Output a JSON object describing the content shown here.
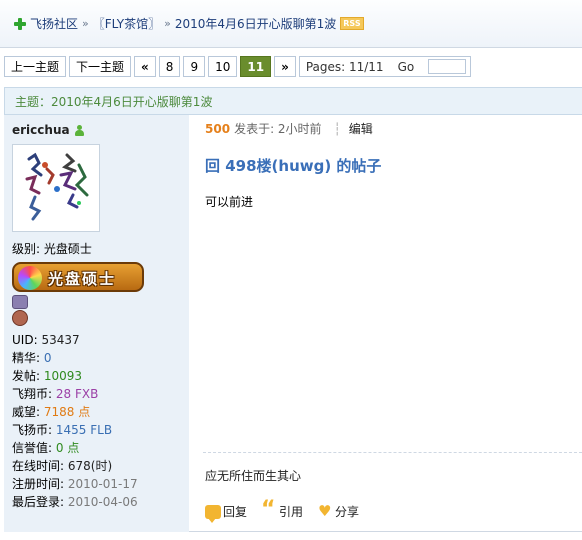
{
  "breadcrumb": {
    "items": [
      "飞扬社区",
      "〖FLY茶馆〗",
      "2010年4月6日开心版聊第1波"
    ],
    "separator": "»",
    "rss": "RSS"
  },
  "pager": {
    "prev_topic": "上一主题",
    "next_topic": "下一主题",
    "first": "«",
    "pages": [
      "8",
      "9",
      "10",
      "11"
    ],
    "current_page": "11",
    "next": "»",
    "pages_info": "Pages: 11/11",
    "go_label": "Go"
  },
  "subject": "主题：2010年4月6日开心版聊第1波",
  "author": {
    "name": "ericchua",
    "level": "级别: 光盘硕士",
    "badge_text": "光盘硕士",
    "stats": [
      {
        "label": "UID:",
        "value": "53437",
        "color": "#222222"
      },
      {
        "label": "精华:",
        "value": "0",
        "color": "#3a6fb3"
      },
      {
        "label": "发帖:",
        "value": "10093",
        "color": "#2f8a1e"
      },
      {
        "label": "飞翔币:",
        "value": "28 FXB",
        "color": "#9b3fa6"
      },
      {
        "label": "威望:",
        "value": "7188 点",
        "color": "#e07b14"
      },
      {
        "label": "飞扬币:",
        "value": "1455 FLB",
        "color": "#3a6fb3"
      },
      {
        "label": "信誉值:",
        "value": "0 点",
        "color": "#2f8a1e"
      },
      {
        "label": "在线时间:",
        "value": "678(时)",
        "color": "#222222"
      },
      {
        "label": "注册时间:",
        "value": "2010-01-17",
        "color": "#7a7a7a"
      },
      {
        "label": "最后登录:",
        "value": "2010-04-06",
        "color": "#7a7a7a"
      }
    ]
  },
  "post": {
    "floor": "500",
    "time": "发表于: 2小时前",
    "separator": "┆",
    "edit": "编辑",
    "title": "回 498楼(huwg) 的帖子",
    "body": "可以前进",
    "signature": "应无所住而生其心",
    "actions": {
      "reply": "回复",
      "quote": "引用",
      "share": "分享"
    }
  },
  "colors": {
    "accent": "#3a6fb8",
    "current_page": "#6a8d2d",
    "subject": "#4c8a3c",
    "floor": "#e5801b"
  }
}
